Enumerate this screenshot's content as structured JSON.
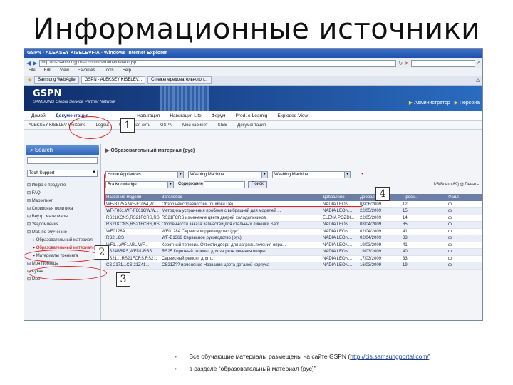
{
  "slide": {
    "title": "Информационные источники",
    "bullets": [
      {
        "prefix": "Все обучающие материалы размещены на сайте GSPN (",
        "link": "http://cis.samsungportal.com/",
        "suffix": ")"
      },
      {
        "prefix": "в разделе “образовательный материал (рус)”",
        "link": "",
        "suffix": ""
      }
    ],
    "callout_numbers": [
      "1",
      "2",
      "3",
      "4"
    ]
  },
  "browser": {
    "window_title": "GSPN - ALEKSEY KISELEVFIA - Windows Internet Explorer",
    "address": "http://cis.samsungportal.com/ms/frame/Default.jsp",
    "menu": [
      "File",
      "Edit",
      "View",
      "Favorites",
      "Tools",
      "Help"
    ],
    "tabs": [
      "Samsung WebAgile",
      "GSPN - ALEKSEY KISELEV...",
      "Сп ежепередовательного т..."
    ]
  },
  "portal": {
    "logo": "GSPN",
    "tagline": "SAMSUNG Global Service Partner Network",
    "admin": "Администратор",
    "person": "Персона",
    "nav": [
      "Домой",
      "Документация",
      "Навигация",
      "Навигация Lite",
      "Форум",
      "Prod. e-Learnig",
      "Exploded View"
    ],
    "subnav": [
      "ALEKSEY KISELEV Welcome",
      "Logout",
      "Сервисная сеть",
      "GSPN",
      "Мой кабинет",
      "SIEB",
      "Документация"
    ]
  },
  "sidebar": {
    "search_label": "Search",
    "select_value": "Tech Support",
    "items": [
      {
        "label": "Инфо о продукте",
        "child": false,
        "highlight": false
      },
      {
        "label": "FAQ",
        "child": false,
        "highlight": false
      },
      {
        "label": "Маркетинг",
        "child": false,
        "highlight": false
      },
      {
        "label": "Сервисная политика",
        "child": false,
        "highlight": false
      },
      {
        "label": "Внутр. материалы",
        "child": false,
        "highlight": false
      },
      {
        "label": "Уведомления",
        "child": false,
        "highlight": false
      },
      {
        "label": "Мат. по обучению",
        "child": false,
        "highlight": false
      },
      {
        "label": "Образовательный материал",
        "child": true,
        "highlight": false
      },
      {
        "label": "Образовательный материал (рус)",
        "child": true,
        "highlight": true
      },
      {
        "label": "Материалы тренинга",
        "child": true,
        "highlight": false
      },
      {
        "label": "Моя Помощь",
        "child": false,
        "highlight": false
      },
      {
        "label": "Кухня",
        "child": false,
        "highlight": false
      },
      {
        "label": "Мое",
        "child": false,
        "highlight": false
      }
    ]
  },
  "main": {
    "title": "Образовательный материал (рус)",
    "filters": {
      "category": "Home Appliances",
      "product": "Washing Machine",
      "subproduct": "Washing Machine",
      "kind": "Bra Knowledge",
      "search_label": "Содержание",
      "find_button": "Поиск"
    },
    "page_info": "1/5(Всего:89)",
    "print_label": "Печать",
    "columns": [
      "Название модели",
      "Заголовок",
      "Добавлено",
      "Добавлено",
      "Просм.",
      "Файл"
    ],
    "rows": [
      [
        "WF-B125A,WF-F1054,W...",
        "Обзор неисправностей (ошибки Ue).",
        "NADIA LEON...",
        "03/06/2009",
        "12",
        "ф"
      ],
      [
        "WF-F861,WF-F861GW,W...",
        "Методика устранения проблем с вибрацией для моделей ...",
        "NADIA LEON...",
        "22/05/2009",
        "15",
        "ф"
      ],
      [
        "RS21KCNS,RS21FCRS,RS2...",
        "RS21FCRS изменение цвета дверей холодильников",
        "ELENA POZDI...",
        "22/05/2009",
        "14",
        "ф"
      ],
      [
        "RS21KCNS,RS21FCRS,RS2...",
        "Особенности заказа запчастей для стальных линейки Sam...",
        "NADIA LEON...",
        "08/04/2009",
        "85",
        "ф"
      ],
      [
        "WF0128A",
        "WF0128A Сервисное руководство (рус)",
        "NADIA LEON...",
        "02/04/2009",
        "41",
        "ф"
      ],
      [
        "RS2...CS",
        "WF-B1366 Сервисное руководство (рус)",
        "NADIA LEON...",
        "02/04/2009",
        "33",
        "ф"
      ],
      [
        "WF1...,WF1ABL,WF...",
        "Коротный телевиз. Отвести двери для загрязн.печения опра...",
        "NADIA LEON...",
        "19/03/2009",
        "41",
        "ф"
      ],
      [
        "RS24BRPS,WFD1-RBS",
        "RS25 Коротный телевиз для загрязн.печения опоры...",
        "NADIA LEON...",
        "19/03/2009",
        "40",
        "ф"
      ],
      [
        "RS21...,RS21FCRS,RS2...",
        "Сервисный ремонт для т...",
        "NADIA LEON...",
        "17/03/2009",
        "33",
        "ф"
      ],
      [
        "CS 2171...CS 21Z41...",
        "CS21Z?? изменение Названия цвета деталей корпуса",
        "NADIA LEON...",
        "16/03/2009",
        "19",
        "ф"
      ]
    ],
    "pager": "1"
  }
}
